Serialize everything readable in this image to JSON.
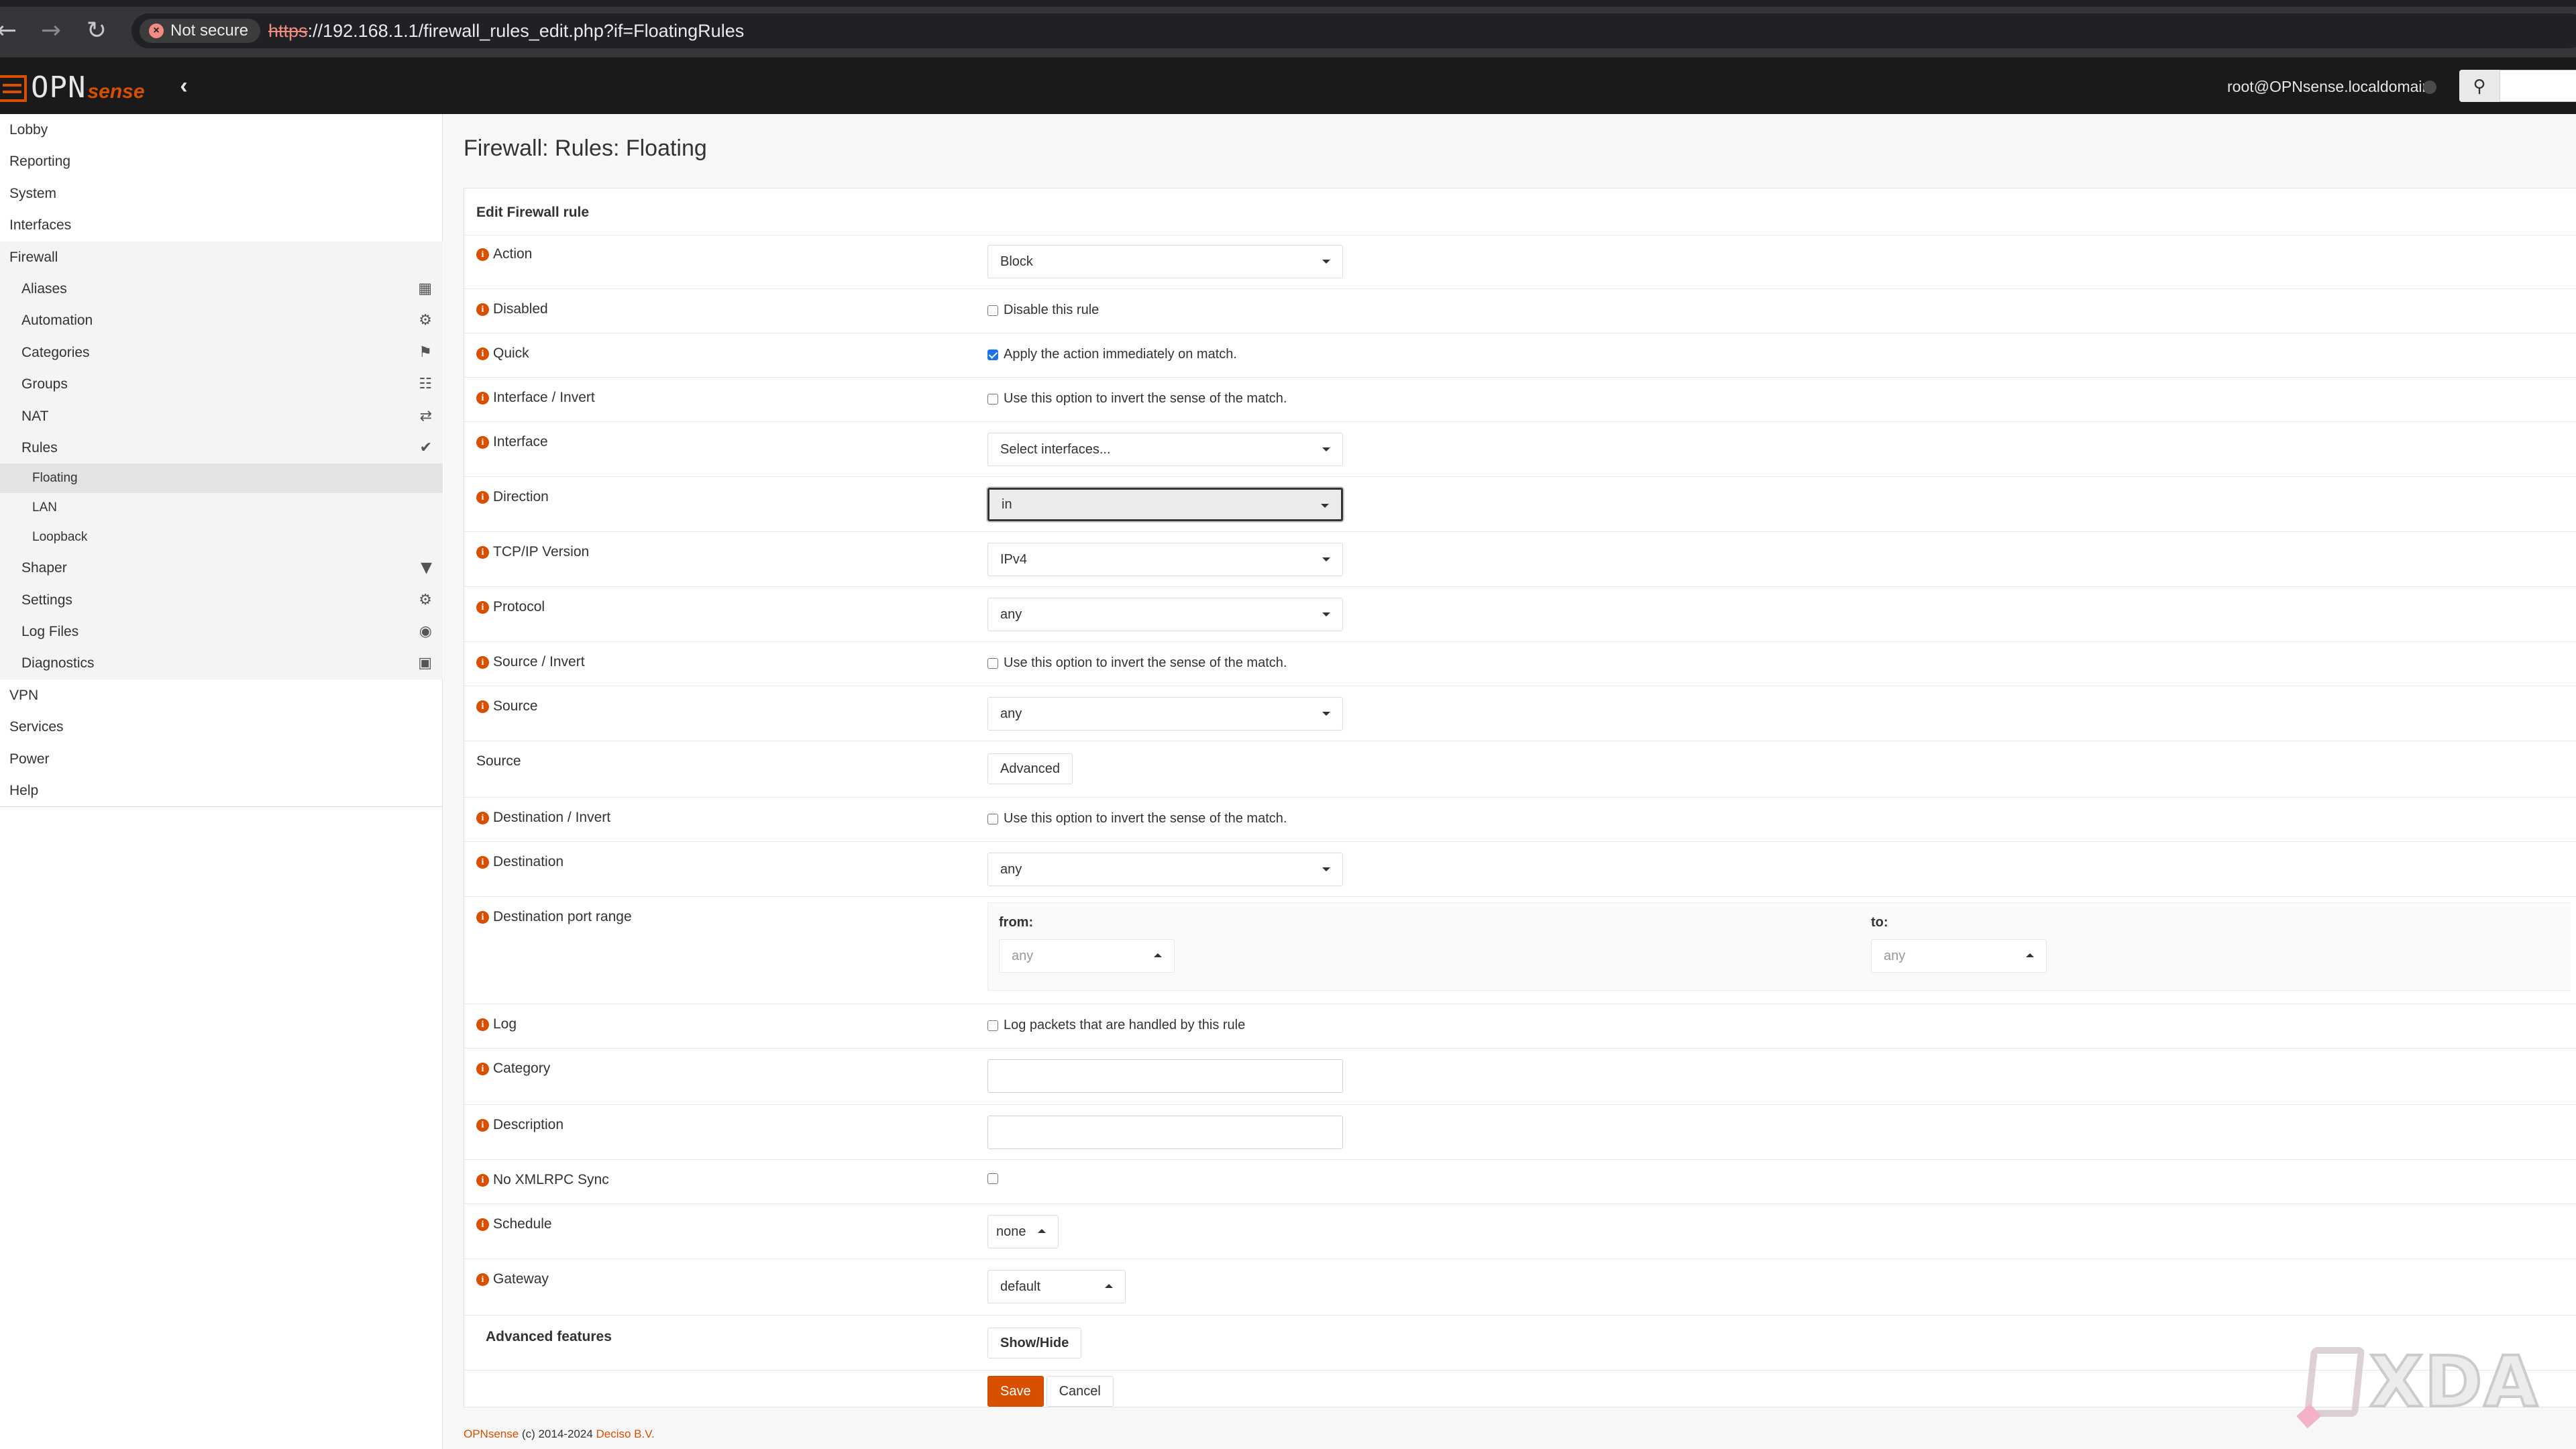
{
  "browser": {
    "security_label": "Not secure",
    "url_scheme": "https",
    "url_rest": "://192.168.1.1/firewall_rules_edit.php?if=FloatingRules"
  },
  "header": {
    "logo_opn": "OPN",
    "logo_sense": "sense",
    "user": "root@OPNsense.localdomain",
    "brand_color": "#d94f00"
  },
  "sidebar": {
    "items": [
      {
        "label": "Lobby"
      },
      {
        "label": "Reporting"
      },
      {
        "label": "System"
      },
      {
        "label": "Interfaces"
      },
      {
        "label": "Firewall"
      },
      {
        "label": "Aliases",
        "icon": "table-icon"
      },
      {
        "label": "Automation",
        "icon": "gear-icon"
      },
      {
        "label": "Categories",
        "icon": "tags-icon"
      },
      {
        "label": "Groups",
        "icon": "sitemap-icon"
      },
      {
        "label": "NAT",
        "icon": "exchange-icon"
      },
      {
        "label": "Rules",
        "icon": "check-icon"
      },
      {
        "label": "Floating"
      },
      {
        "label": "LAN"
      },
      {
        "label": "Loopback"
      },
      {
        "label": "Shaper",
        "icon": "filter-icon"
      },
      {
        "label": "Settings",
        "icon": "cogs-icon"
      },
      {
        "label": "Log Files",
        "icon": "eye-icon"
      },
      {
        "label": "Diagnostics",
        "icon": "medkit-icon"
      },
      {
        "label": "VPN"
      },
      {
        "label": "Services"
      },
      {
        "label": "Power"
      },
      {
        "label": "Help"
      }
    ]
  },
  "page": {
    "title": "Firewall: Rules: Floating",
    "section": "Edit Firewall rule"
  },
  "form": {
    "action": {
      "label": "Action",
      "value": "Block"
    },
    "disabled": {
      "label": "Disabled",
      "text": "Disable this rule"
    },
    "quick": {
      "label": "Quick",
      "text": "Apply the action immediately on match."
    },
    "interface_invert": {
      "label": "Interface / Invert",
      "text": "Use this option to invert the sense of the match."
    },
    "interface": {
      "label": "Interface",
      "value": "Select interfaces..."
    },
    "direction": {
      "label": "Direction",
      "value": "in"
    },
    "ipversion": {
      "label": "TCP/IP Version",
      "value": "IPv4"
    },
    "protocol": {
      "label": "Protocol",
      "value": "any"
    },
    "source_invert": {
      "label": "Source / Invert",
      "text": "Use this option to invert the sense of the match."
    },
    "source": {
      "label": "Source",
      "value": "any"
    },
    "source_adv": {
      "label": "Source",
      "button": "Advanced"
    },
    "dest_invert": {
      "label": "Destination / Invert",
      "text": "Use this option to invert the sense of the match."
    },
    "destination": {
      "label": "Destination",
      "value": "any"
    },
    "port_range": {
      "label": "Destination port range",
      "from_label": "from:",
      "to_label": "to:",
      "from_value": "any",
      "to_value": "any"
    },
    "log": {
      "label": "Log",
      "text": "Log packets that are handled by this rule"
    },
    "category": {
      "label": "Category",
      "value": ""
    },
    "description": {
      "label": "Description",
      "value": ""
    },
    "nosync": {
      "label": "No XMLRPC Sync"
    },
    "schedule": {
      "label": "Schedule",
      "value": "none"
    },
    "gateway": {
      "label": "Gateway",
      "value": "default"
    },
    "advanced": {
      "label": "Advanced features",
      "button": "Show/Hide"
    },
    "save": "Save",
    "cancel": "Cancel"
  },
  "footer": {
    "brand": "OPNsense",
    "copyright": " (c) 2014-2024 ",
    "company": "Deciso B.V."
  },
  "watermark": "XDA"
}
